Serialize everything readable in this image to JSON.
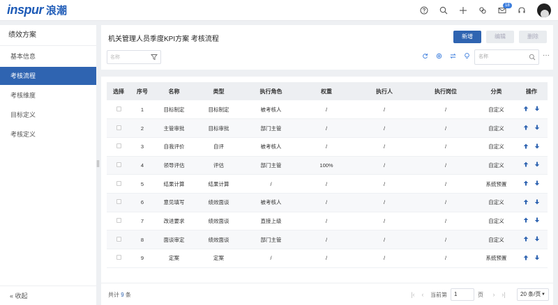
{
  "brand": {
    "logo_en": "inspur",
    "logo_cn": "浪潮"
  },
  "topbar": {
    "mail_badge": "18"
  },
  "sidebar": {
    "title": "绩效方案",
    "items": [
      {
        "label": "基本信息",
        "active": false
      },
      {
        "label": "考核流程",
        "active": true
      },
      {
        "label": "考核维度",
        "active": false
      },
      {
        "label": "目标定义",
        "active": false
      },
      {
        "label": "考核定义",
        "active": false
      }
    ],
    "collapse_label": "收起"
  },
  "main": {
    "title": "机关管理人员季度KPI方案  考核流程",
    "buttons": {
      "new": "新增",
      "edit": "编辑",
      "delete": "删除"
    },
    "filter_placeholder": "名称",
    "search_placeholder": "名称",
    "more": "···"
  },
  "table": {
    "headers": [
      "选择",
      "序号",
      "名称",
      "类型",
      "执行角色",
      "权重",
      "执行人",
      "执行岗位",
      "分类",
      "操作"
    ],
    "rows": [
      {
        "no": "1",
        "name": "目标制定",
        "type": "目标制定",
        "role": "被考核人",
        "weight": "/",
        "executor": "/",
        "post": "/",
        "category": "自定义"
      },
      {
        "no": "2",
        "name": "主管审批",
        "type": "目标审批",
        "role": "部门主管",
        "weight": "/",
        "executor": "/",
        "post": "/",
        "category": "自定义"
      },
      {
        "no": "3",
        "name": "自我评价",
        "type": "自评",
        "role": "被考核人",
        "weight": "/",
        "executor": "/",
        "post": "/",
        "category": "自定义"
      },
      {
        "no": "4",
        "name": "领导评估",
        "type": "评估",
        "role": "部门主管",
        "weight": "100%",
        "executor": "/",
        "post": "/",
        "category": "自定义"
      },
      {
        "no": "5",
        "name": "结果计算",
        "type": "结果计算",
        "role": "/",
        "weight": "/",
        "executor": "/",
        "post": "/",
        "category": "系统预置"
      },
      {
        "no": "6",
        "name": "意见填写",
        "type": "绩效面谈",
        "role": "被考核人",
        "weight": "/",
        "executor": "/",
        "post": "/",
        "category": "自定义"
      },
      {
        "no": "7",
        "name": "改进要求",
        "type": "绩效面谈",
        "role": "直接上级",
        "weight": "/",
        "executor": "/",
        "post": "/",
        "category": "自定义"
      },
      {
        "no": "8",
        "name": "面谈审定",
        "type": "绩效面谈",
        "role": "部门主管",
        "weight": "/",
        "executor": "/",
        "post": "/",
        "category": "自定义"
      },
      {
        "no": "9",
        "name": "定案",
        "type": "定案",
        "role": "/",
        "weight": "/",
        "executor": "/",
        "post": "/",
        "category": "系统预置"
      }
    ]
  },
  "footer": {
    "total_prefix": "共计",
    "total_count": "9",
    "total_suffix": "条",
    "current_page_label": "当前第",
    "current_page": "1",
    "page_suffix": "页",
    "page_size": "20 条/页"
  },
  "colors": {
    "primary": "#2f64b1",
    "disabled_btn": "#e9ecef"
  }
}
